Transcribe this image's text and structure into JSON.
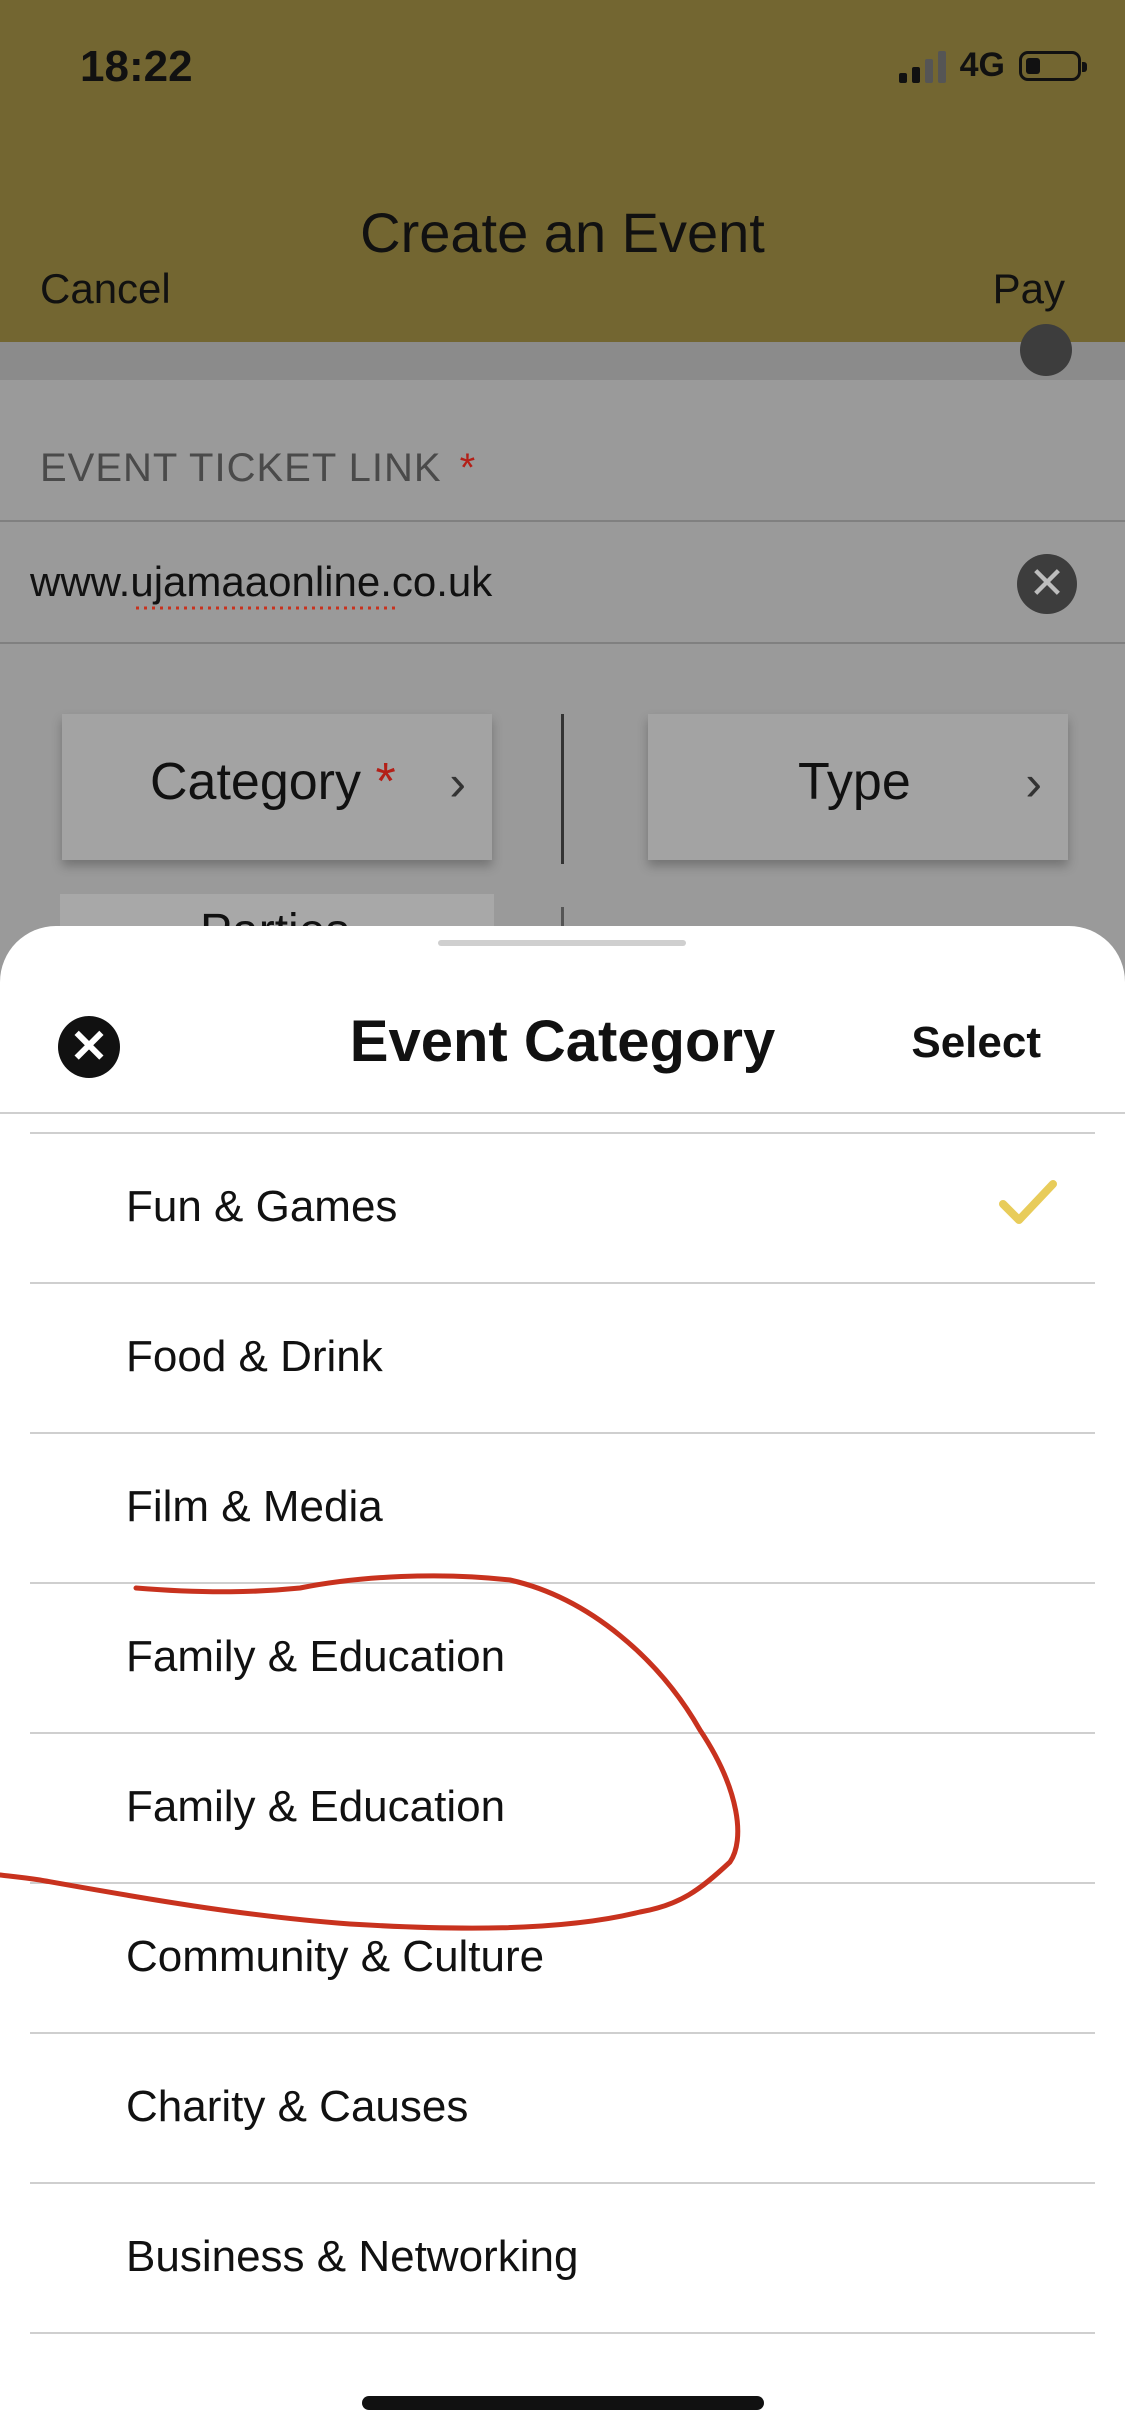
{
  "status_bar": {
    "time": "18:22",
    "network": "4G"
  },
  "nav": {
    "title": "Create an Event",
    "cancel_label": "Cancel",
    "pay_label": "Pay"
  },
  "form": {
    "ticket_link_label": "EVENT TICKET LINK",
    "required_mark": "*",
    "ticket_link_value": "www.ujamaaonline.co.uk",
    "category_label": "Category",
    "type_label": "Type",
    "selected_category_partial": "Parties"
  },
  "sheet": {
    "title": "Event Category",
    "select_label": "Select",
    "items": [
      {
        "label": "Fun & Games",
        "selected": true
      },
      {
        "label": "Food & Drink",
        "selected": false
      },
      {
        "label": "Film & Media",
        "selected": false
      },
      {
        "label": "Family & Education",
        "selected": false
      },
      {
        "label": "Family & Education",
        "selected": false
      },
      {
        "label": "Community & Culture",
        "selected": false
      },
      {
        "label": "Charity & Causes",
        "selected": false
      },
      {
        "label": "Business & Networking",
        "selected": false
      }
    ]
  },
  "colors": {
    "header_bg": "#736631",
    "overlay_gray": "#9a9a9a",
    "check_color": "#e8cc5a",
    "annotation_red": "#c8321e",
    "required_red": "#b32018"
  },
  "icons": {
    "clear": "close-circle-icon",
    "chevron": "chevron-right-icon",
    "sheet_close": "close-circle-icon",
    "selected": "checkmark-icon"
  }
}
